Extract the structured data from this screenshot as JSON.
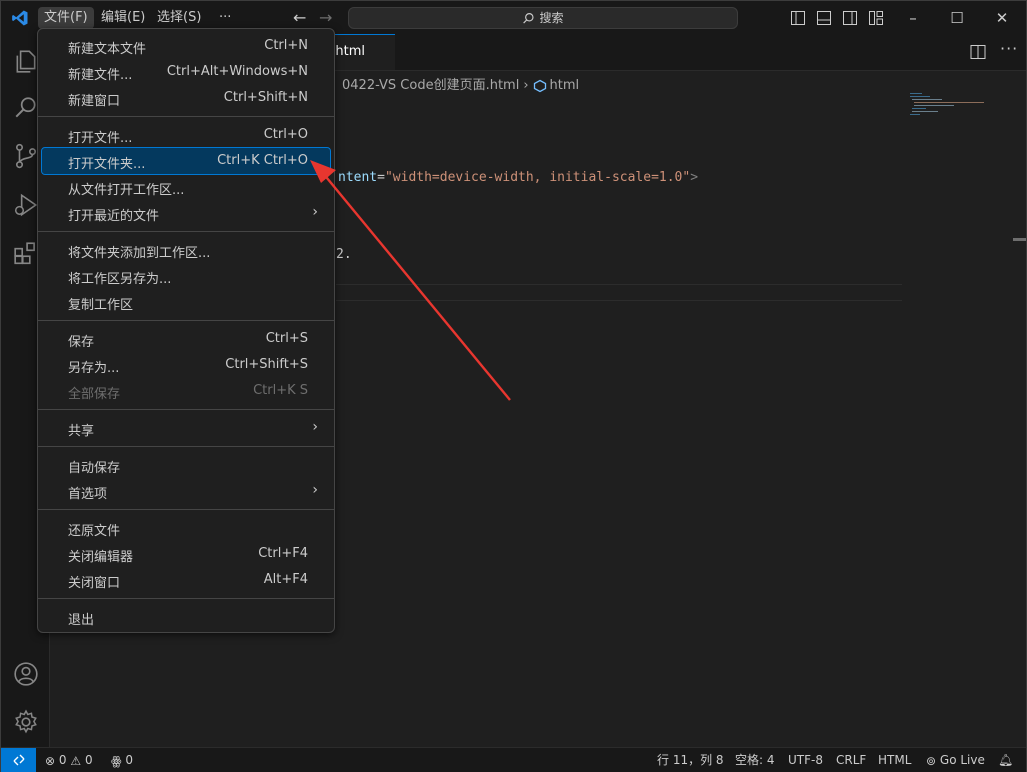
{
  "titlebar": {
    "menus": [
      "文件(F)",
      "编辑(E)",
      "选择(S)"
    ],
    "more": "···",
    "search_label": "搜索"
  },
  "tab": {
    "title": ".html"
  },
  "breadcrumb": {
    "file": "0422-VS Code创建页面.html",
    "symbol": "html"
  },
  "code": {
    "line_meta_attr": "ntent",
    "line_meta_eq": "=",
    "line_meta_value": "\"width=device-width, initial-scale=1.0\"",
    "line_meta_close": ">",
    "line_text": "2."
  },
  "menu": {
    "groups": [
      [
        {
          "label": "新建文本文件",
          "key": "Ctrl+N"
        },
        {
          "label": "新建文件...",
          "key": "Ctrl+Alt+Windows+N"
        },
        {
          "label": "新建窗口",
          "key": "Ctrl+Shift+N"
        }
      ],
      [
        {
          "label": "打开文件...",
          "key": "Ctrl+O"
        },
        {
          "label": "打开文件夹...",
          "key": "Ctrl+K Ctrl+O",
          "highlighted": true
        },
        {
          "label": "从文件打开工作区...",
          "key": ""
        },
        {
          "label": "打开最近的文件",
          "key": "",
          "submenu": true
        }
      ],
      [
        {
          "label": "将文件夹添加到工作区...",
          "key": ""
        },
        {
          "label": "将工作区另存为...",
          "key": ""
        },
        {
          "label": "复制工作区",
          "key": ""
        }
      ],
      [
        {
          "label": "保存",
          "key": "Ctrl+S"
        },
        {
          "label": "另存为...",
          "key": "Ctrl+Shift+S"
        },
        {
          "label": "全部保存",
          "key": "Ctrl+K S",
          "disabled": true
        }
      ],
      [
        {
          "label": "共享",
          "key": "",
          "submenu": true
        }
      ],
      [
        {
          "label": "自动保存",
          "key": ""
        },
        {
          "label": "首选项",
          "key": "",
          "submenu": true
        }
      ],
      [
        {
          "label": "还原文件",
          "key": ""
        },
        {
          "label": "关闭编辑器",
          "key": "Ctrl+F4"
        },
        {
          "label": "关闭窗口",
          "key": "Alt+F4"
        }
      ],
      [
        {
          "label": "退出",
          "key": ""
        }
      ]
    ]
  },
  "statusbar": {
    "errors": "0",
    "warnings": "0",
    "ports": "0",
    "position": "行 11，列 8",
    "spaces": "空格: 4",
    "encoding": "UTF-8",
    "eol": "CRLF",
    "language": "HTML",
    "golive": "Go Live"
  },
  "colors": {
    "accent": "#0078d4",
    "menu_highlight": "#04395e",
    "arrow": "#e8362f"
  }
}
